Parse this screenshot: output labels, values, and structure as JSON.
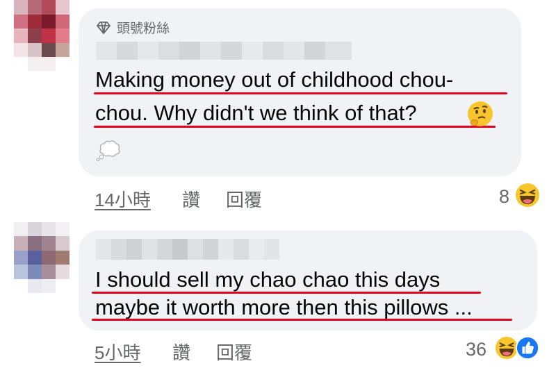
{
  "comments": [
    {
      "badge": "頭號粉絲",
      "line1": "Making money out of childhood chou-",
      "line2": "chou. Why didn't we think of that?",
      "time": "14小時",
      "like": "讚",
      "reply": "回覆",
      "reaction_count": "8",
      "reaction_icons": [
        "laugh-icon"
      ]
    },
    {
      "line1": "I should sell my chao chao this days",
      "line2": "maybe it worth more then this pillows ...",
      "time": "5小時",
      "like": "讚",
      "reply": "回覆",
      "reaction_count": "36",
      "reaction_icons": [
        "laugh-icon",
        "like-icon"
      ]
    }
  ],
  "colors": {
    "bubble": "#f0f2f5",
    "underline": "#e3001b",
    "meta": "#65676b",
    "like_blue": "#1877f2",
    "laugh_yellow": "#f7c52c"
  }
}
